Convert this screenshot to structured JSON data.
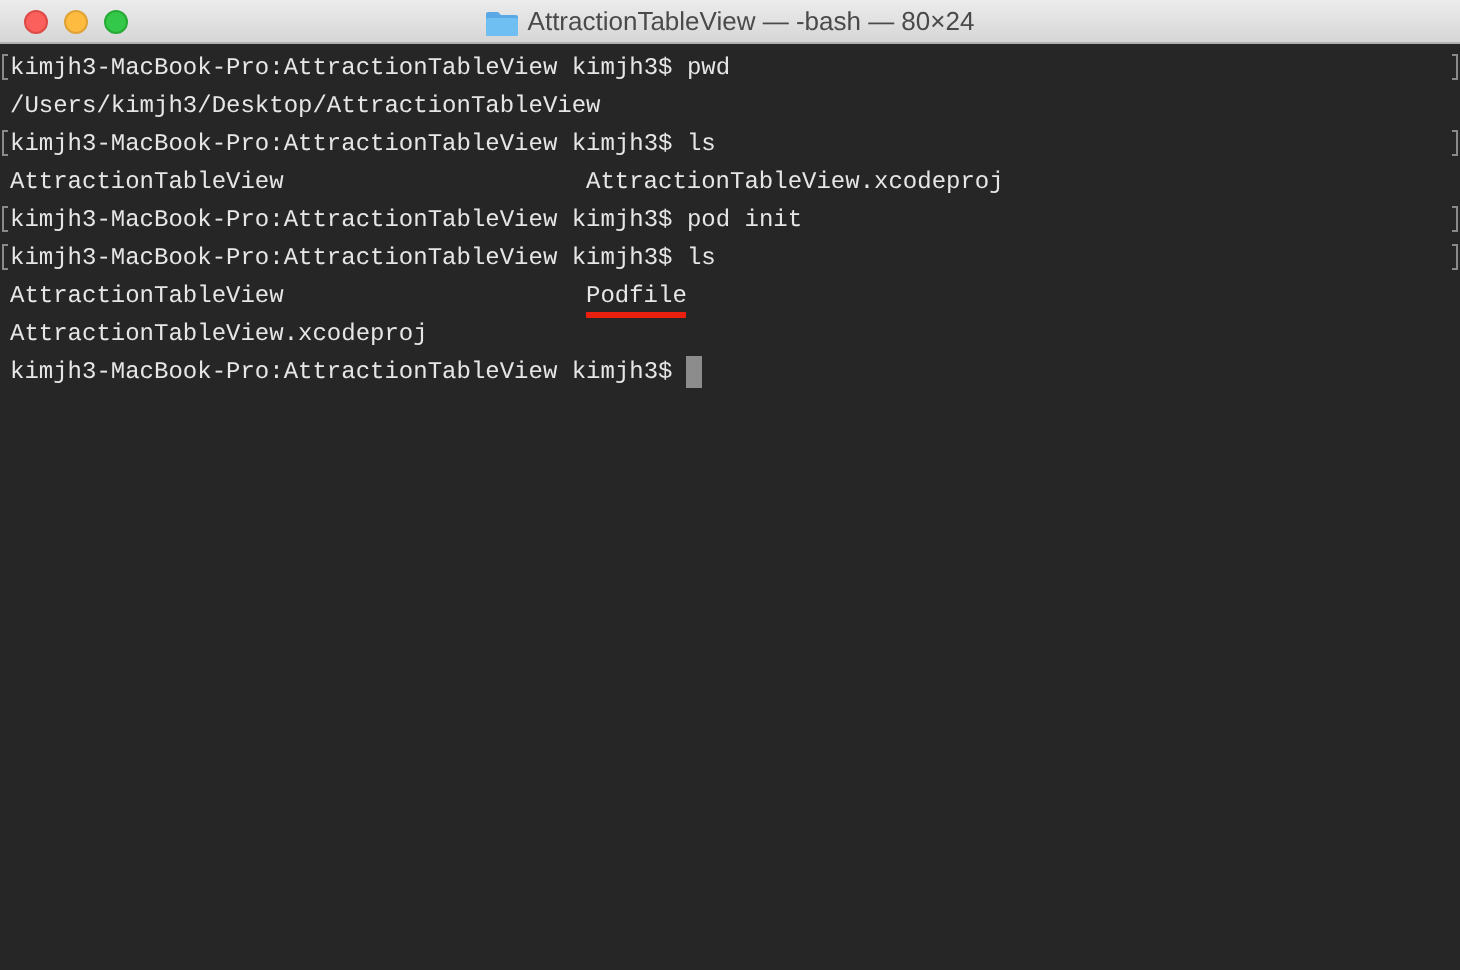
{
  "window": {
    "title": "AttractionTableView — -bash — 80×24"
  },
  "lines": [
    {
      "marked": true,
      "cursor": false,
      "cells": [
        {
          "text": "kimjh3-MacBook-Pro:AttractionTableView kimjh3$ pwd",
          "underlined": false
        }
      ]
    },
    {
      "marked": false,
      "cursor": false,
      "cells": [
        {
          "text": "/Users/kimjh3/Desktop/AttractionTableView",
          "underlined": false
        }
      ]
    },
    {
      "marked": true,
      "cursor": false,
      "cells": [
        {
          "text": "kimjh3-MacBook-Pro:AttractionTableView kimjh3$ ls",
          "underlined": false
        }
      ]
    },
    {
      "marked": false,
      "cursor": false,
      "cells": [
        {
          "text": "AttractionTableView",
          "underlined": false
        },
        {
          "text": "AttractionTableView.xcodeproj",
          "underlined": false
        }
      ]
    },
    {
      "marked": true,
      "cursor": false,
      "cells": [
        {
          "text": "kimjh3-MacBook-Pro:AttractionTableView kimjh3$ pod init",
          "underlined": false
        }
      ]
    },
    {
      "marked": true,
      "cursor": false,
      "cells": [
        {
          "text": "kimjh3-MacBook-Pro:AttractionTableView kimjh3$ ls",
          "underlined": false
        }
      ]
    },
    {
      "marked": false,
      "cursor": false,
      "cells": [
        {
          "text": "AttractionTableView",
          "underlined": false
        },
        {
          "text": "Podfile",
          "underlined": true
        }
      ]
    },
    {
      "marked": false,
      "cursor": false,
      "cells": [
        {
          "text": "AttractionTableView.xcodeproj",
          "underlined": false
        }
      ]
    },
    {
      "marked": false,
      "cursor": true,
      "cells": [
        {
          "text": "kimjh3-MacBook-Pro:AttractionTableView kimjh3$",
          "underlined": false
        }
      ]
    }
  ]
}
